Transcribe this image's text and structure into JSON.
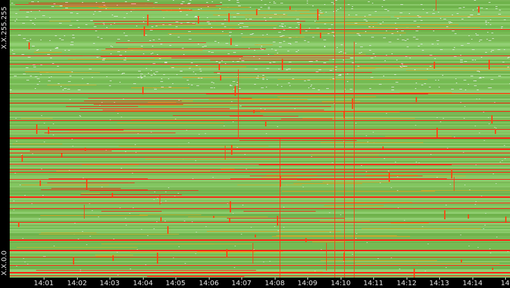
{
  "axis": {
    "y_top_label": "X.X.255.255",
    "y_bottom_label": "X.X.0.0",
    "x_ticks": [
      "14:01",
      "14:02",
      "14:03",
      "14:04",
      "14:05",
      "14:06",
      "14:07",
      "14:08",
      "14:09",
      "14:10",
      "14:11",
      "14:12",
      "14:13",
      "14:14",
      "14"
    ]
  },
  "colors": {
    "background": "#000000",
    "low": "#7ec25a",
    "mid": "#e0a020",
    "high": "#ff2010",
    "sparse": "#e6ecea"
  }
}
